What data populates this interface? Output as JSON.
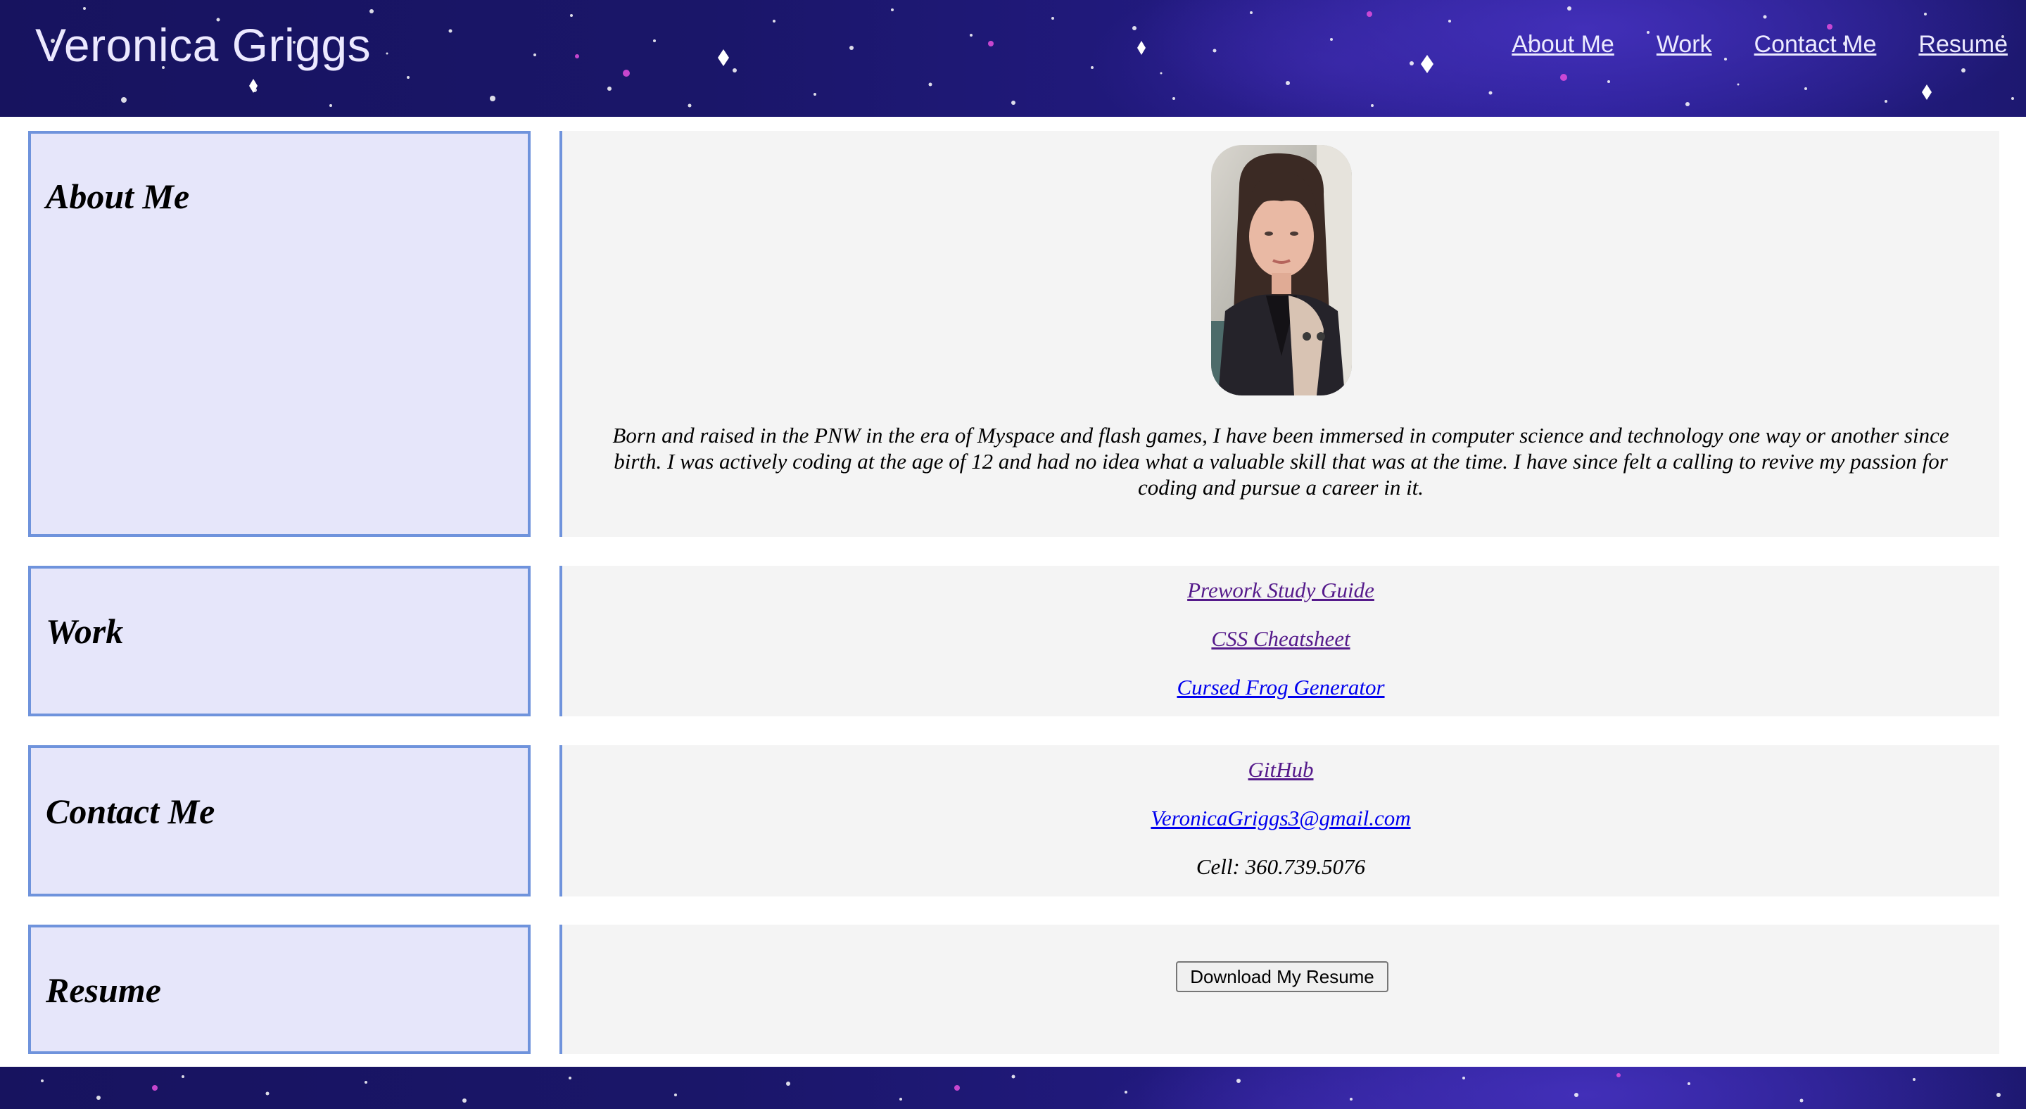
{
  "header": {
    "site_title": "Veronica Griggs",
    "nav": [
      "About Me",
      "Work",
      "Contact Me",
      "Resume"
    ]
  },
  "sections": {
    "about": {
      "heading": "About Me",
      "bio": "Born and raised in the PNW in the era of Myspace and flash games, I have been immersed in computer science and technology one way or another since birth. I was actively coding at the age of 12 and had no idea what a valuable skill that was at the time. I have since felt a calling to revive my passion for coding and pursue a career in it."
    },
    "work": {
      "heading": "Work",
      "links": [
        "Prework Study Guide",
        "CSS Cheatsheet",
        "Cursed Frog Generator"
      ]
    },
    "contact": {
      "heading": "Contact Me",
      "github": "GitHub",
      "email": "VeronicaGriggs3@gmail.com",
      "cell": "Cell: 360.739.5076"
    },
    "resume": {
      "heading": "Resume",
      "button_label": "Download My Resume"
    }
  },
  "colors": {
    "space_dark": "#17135f",
    "space_glow": "#2a1f96",
    "label_bg": "#e6e6fa",
    "label_border": "#6f93dc",
    "content_bg": "#f4f4f4",
    "visited_link": "#551a8b",
    "unvisited_link": "#0000ee"
  }
}
